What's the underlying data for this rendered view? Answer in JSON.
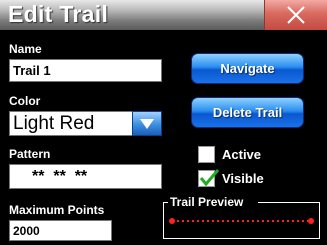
{
  "window": {
    "title": "Edit Trail"
  },
  "name": {
    "label": "Name",
    "value": "Trail 1"
  },
  "color": {
    "label": "Color",
    "value": "Light Red",
    "accent": "#ff3030"
  },
  "pattern": {
    "label": "Pattern",
    "value": "**  **  **"
  },
  "max_points": {
    "label": "Maximum Points",
    "value": "2000"
  },
  "buttons": {
    "navigate": "Navigate",
    "delete": "Delete Trail"
  },
  "checkboxes": {
    "active": {
      "label": "Active",
      "checked": false
    },
    "visible": {
      "label": "Visible",
      "checked": true
    }
  },
  "preview": {
    "label": "Trail Preview"
  },
  "icons": {
    "close": "close-icon",
    "dropdown": "chevron-down-icon",
    "check": "checkmark-icon"
  }
}
